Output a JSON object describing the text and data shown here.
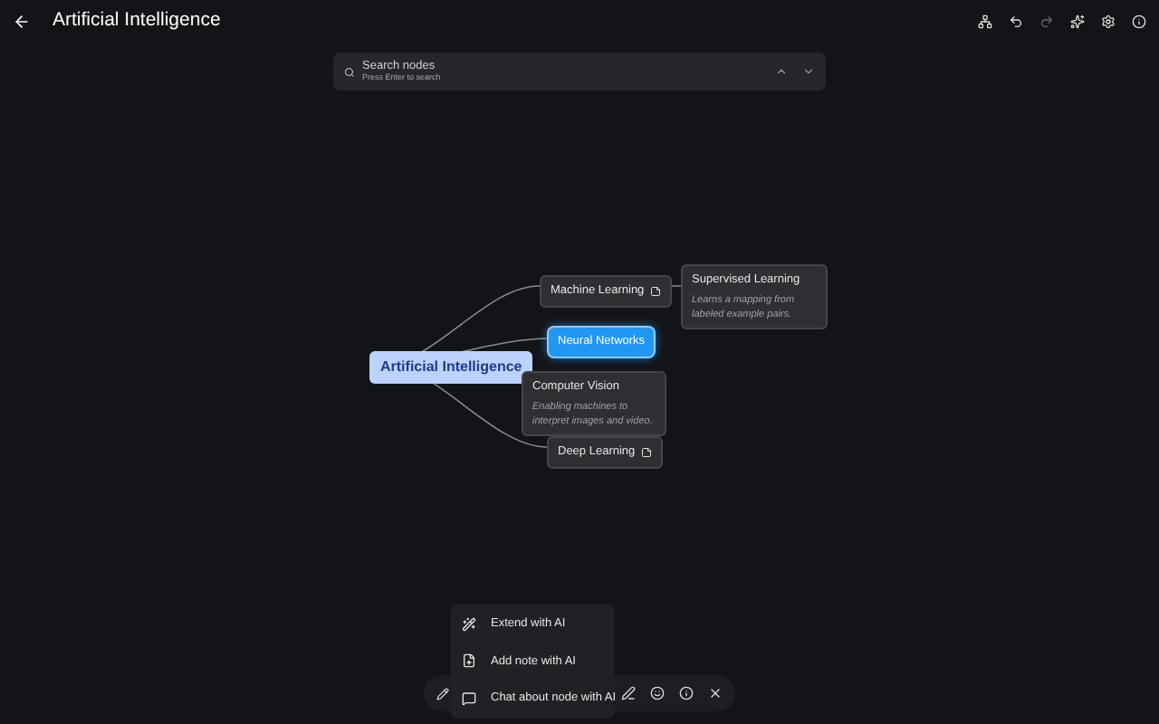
{
  "header": {
    "title": "Artificial Intelligence"
  },
  "search": {
    "placeholder": "Search nodes",
    "hint": "Press Enter to search"
  },
  "map": {
    "root": {
      "label": "Artificial Intelligence",
      "selected": false,
      "children": [
        {
          "label": "Machine Learning",
          "selected": false,
          "has_note": true,
          "children": [
            {
              "label": "Supervised Learning",
              "description": "Learns a mapping from labeled example pairs.",
              "selected": false
            }
          ]
        },
        {
          "label": "Neural Networks",
          "selected": true,
          "has_note": false
        },
        {
          "label": "Computer Vision",
          "description": "Enabling machines to interpret images and video.",
          "selected": false,
          "has_note": false
        },
        {
          "label": "Deep Learning",
          "selected": false,
          "has_note": true
        }
      ]
    }
  },
  "ai_menu": [
    {
      "label": "Extend with AI",
      "kind": "extend"
    },
    {
      "label": "Add note with AI",
      "kind": "note"
    },
    {
      "label": "Chat about node with AI",
      "kind": "chat"
    }
  ]
}
